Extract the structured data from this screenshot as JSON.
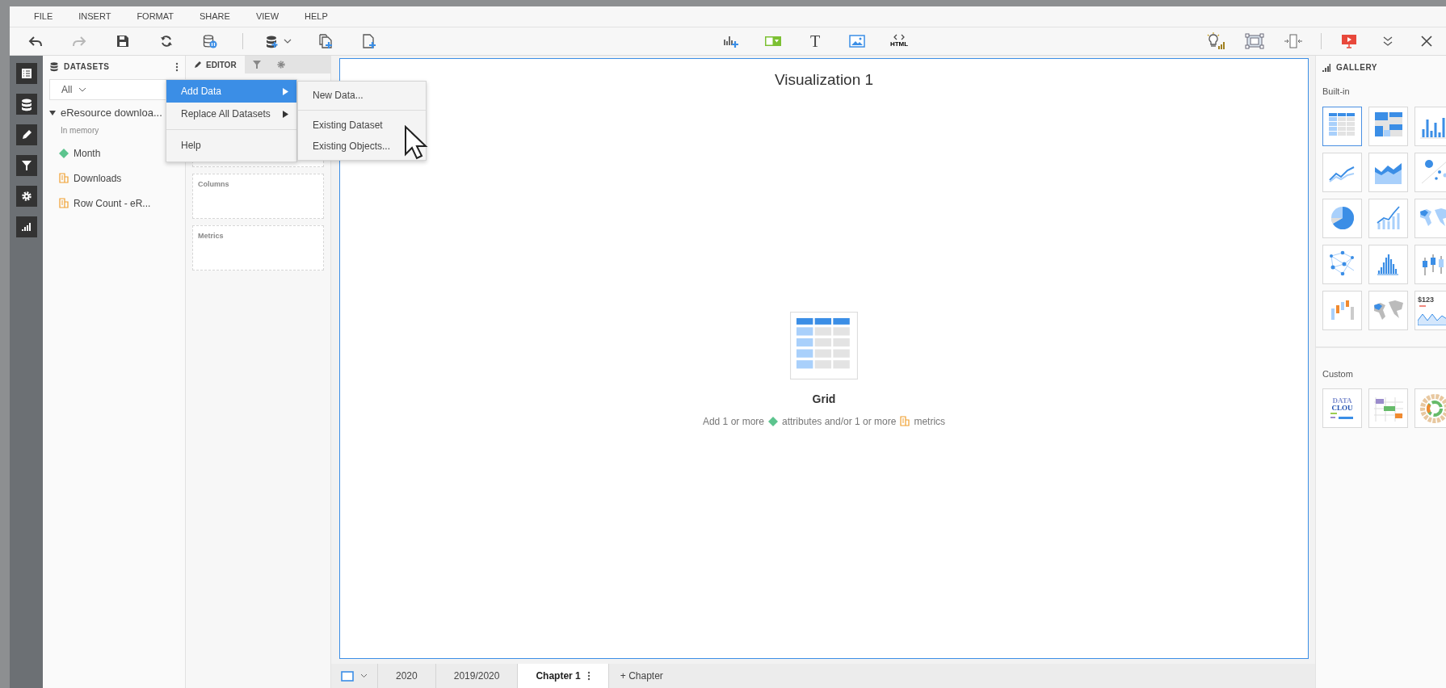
{
  "menu_bar": [
    "FILE",
    "INSERT",
    "FORMAT",
    "SHARE",
    "VIEW",
    "HELP"
  ],
  "toolbar": {
    "left": [
      {
        "kind": "undo",
        "disabled": false
      },
      {
        "kind": "redo",
        "disabled": true
      },
      {
        "kind": "save",
        "disabled": false
      },
      {
        "kind": "refresh",
        "disabled": false
      },
      {
        "kind": "dataset-pause",
        "disabled": false
      },
      {
        "kind": "add-dataset",
        "disabled": false
      },
      {
        "kind": "duplicate-page",
        "disabled": false
      },
      {
        "kind": "new-page",
        "disabled": false
      }
    ],
    "center": [
      {
        "kind": "add-visualization"
      },
      {
        "kind": "filter-selector"
      },
      {
        "kind": "text",
        "label": "T"
      },
      {
        "kind": "image"
      },
      {
        "kind": "html",
        "label": "HTML"
      }
    ],
    "right": [
      {
        "kind": "idea"
      },
      {
        "kind": "fit"
      },
      {
        "kind": "resize"
      },
      {
        "kind": "present"
      },
      {
        "kind": "collapse"
      },
      {
        "kind": "close"
      }
    ]
  },
  "left_rail": [
    {
      "kind": "list"
    },
    {
      "kind": "database"
    },
    {
      "kind": "pencil"
    },
    {
      "kind": "filter"
    },
    {
      "kind": "gear"
    },
    {
      "kind": "chart"
    }
  ],
  "datasets": {
    "title": "DATASETS",
    "filter": "All",
    "dataset": {
      "name": "eResource downloa...",
      "expanded": true,
      "subtitle": "In memory",
      "items": [
        {
          "name": "Month",
          "kind": "attribute"
        },
        {
          "name": "Downloads",
          "kind": "metric"
        },
        {
          "name": "Row Count - eR...",
          "kind": "metric"
        }
      ]
    }
  },
  "editor": {
    "tabs": [
      {
        "kind": "editor",
        "label": "EDITOR",
        "selected": true
      },
      {
        "kind": "filter",
        "selected": false
      },
      {
        "kind": "format",
        "selected": false
      }
    ],
    "drop_zones": [
      "Columns",
      "Metrics"
    ]
  },
  "context_menu": {
    "items": [
      {
        "label": "Add Data",
        "selected": true,
        "submenu": true
      },
      {
        "label": "Replace All Datasets",
        "selected": false,
        "submenu": true
      },
      {
        "label": "Help",
        "selected": false,
        "submenu": false
      }
    ],
    "submenu": [
      {
        "label": "New Data..."
      },
      {
        "label": "Existing Dataset"
      },
      {
        "label": "Existing Objects..."
      }
    ]
  },
  "visualization": {
    "title": "Visualization 1",
    "placeholder_title": "Grid",
    "hint": [
      "Add 1 or more",
      "attributes and/or 1 or more",
      "metrics"
    ]
  },
  "gallery": {
    "title": "GALLERY",
    "sections": [
      {
        "title": "Built-in",
        "items": [
          {
            "kind": "grid",
            "selected": true
          },
          {
            "kind": "heatmap",
            "selected": false
          },
          {
            "kind": "bar",
            "selected": false
          },
          {
            "kind": "line",
            "selected": false
          },
          {
            "kind": "area",
            "selected": false
          },
          {
            "kind": "bubble",
            "selected": false
          },
          {
            "kind": "pie",
            "selected": false
          },
          {
            "kind": "combo",
            "selected": false
          },
          {
            "kind": "map",
            "selected": false
          },
          {
            "kind": "network",
            "selected": false
          },
          {
            "kind": "histogram",
            "selected": false
          },
          {
            "kind": "boxplot",
            "selected": false
          },
          {
            "kind": "waterfall",
            "selected": false
          },
          {
            "kind": "geo",
            "selected": false
          },
          {
            "kind": "kpi",
            "selected": false,
            "text": "$123"
          }
        ]
      },
      {
        "title": "Custom",
        "items": [
          {
            "kind": "wordcloud",
            "selected": false,
            "texts": [
              "DATA",
              "CLOU"
            ]
          },
          {
            "kind": "gantt",
            "selected": false
          },
          {
            "kind": "sunburst",
            "selected": false
          }
        ]
      }
    ]
  },
  "chapter_bar": {
    "pages": [
      {
        "label": "2020",
        "selected": false
      },
      {
        "label": "2019/2020",
        "selected": false
      },
      {
        "label": "Chapter 1",
        "selected": true
      }
    ],
    "add_label": "+ Chapter"
  }
}
